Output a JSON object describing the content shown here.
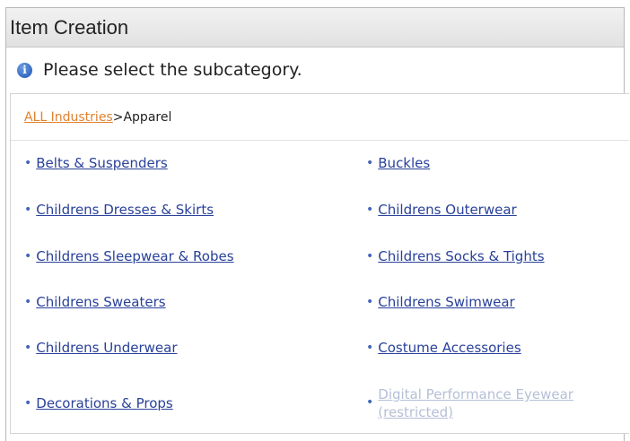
{
  "window": {
    "title": "Item Creation"
  },
  "notice": {
    "icon": "info-icon",
    "text": "Please select the subcategory."
  },
  "breadcrumb": {
    "root": "ALL Industries",
    "separator": ">",
    "current": "Apparel"
  },
  "subcategories": {
    "left": [
      "Belts & Suspenders",
      "Childrens Dresses & Skirts",
      "Childrens Sleepwear & Robes",
      "Childrens Sweaters",
      "Childrens Underwear",
      "Decorations & Props"
    ],
    "right": [
      "Buckles",
      "Childrens Outerwear",
      "Childrens Socks & Tights",
      "Childrens Swimwear",
      "Costume Accessories"
    ],
    "restricted": {
      "line1": "Digital Performance Eyewear",
      "line2": "(restricted)"
    }
  },
  "colors": {
    "link": "#29419a",
    "breadcrumb_link": "#e0822f",
    "disabled": "#b5bfd6"
  }
}
